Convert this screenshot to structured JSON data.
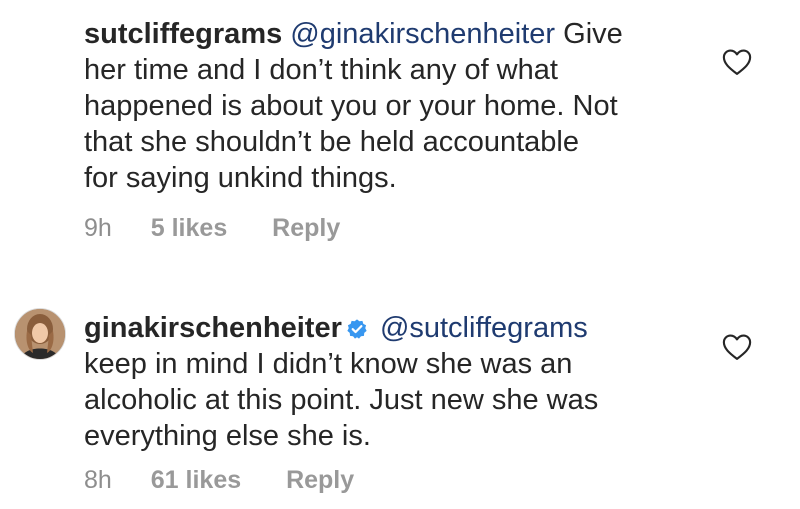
{
  "comments": [
    {
      "username": "sutcliffegrams",
      "mention": "@ginakirschenheiter",
      "text_lines": [
        "Give",
        "her time and I don’t think any of what",
        "happened is about you or your home. Not",
        "that she shouldn’t be held accountable",
        "for saying unkind things."
      ],
      "time": "9h",
      "likes": "5 likes",
      "reply_label": "Reply",
      "like_icon": "heart-outline-icon"
    },
    {
      "username": "ginakirschenheiter",
      "verified": true,
      "mention": "@sutcliffegrams",
      "text_lines": [
        "keep in mind I didn’t know she was an",
        "alcoholic at this point. Just new she was",
        "everything else she is."
      ],
      "time": "8h",
      "likes": "61 likes",
      "reply_label": "Reply",
      "like_icon": "heart-outline-icon",
      "verified_color": "#3897f0"
    }
  ]
}
